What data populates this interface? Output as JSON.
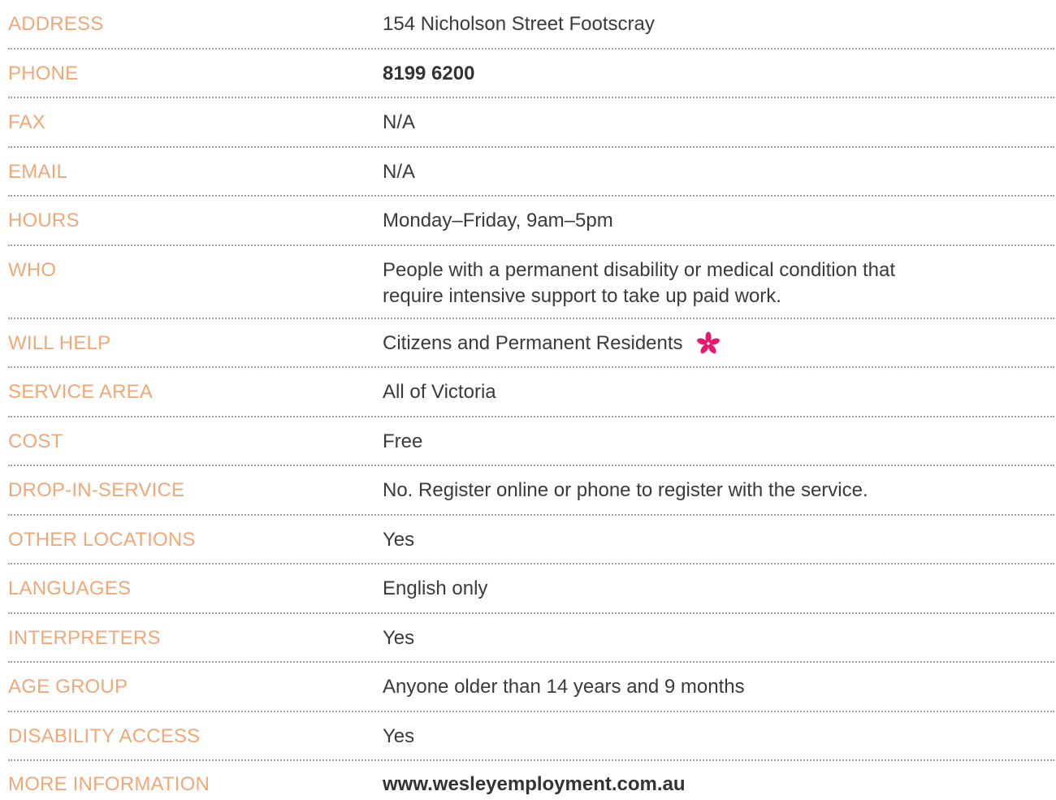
{
  "rows": [
    {
      "label": "ADDRESS",
      "value": "154 Nicholson Street Footscray"
    },
    {
      "label": "PHONE",
      "value": "8199 6200"
    },
    {
      "label": "FAX",
      "value": "N/A"
    },
    {
      "label": "EMAIL",
      "value": "N/A"
    },
    {
      "label": "HOURS",
      "value": "Monday–Friday, 9am–5pm"
    },
    {
      "label": "WHO",
      "value_line1": "People with a permanent disability or medical condition that",
      "value_line2": "require intensive support to take up paid work."
    },
    {
      "label": "WILL HELP",
      "value": "Citizens and Permanent Residents"
    },
    {
      "label": "SERVICE AREA",
      "value": "All of Victoria"
    },
    {
      "label": "COST",
      "value": "Free"
    },
    {
      "label": "DROP-IN-SERVICE",
      "value": "No. Register online or phone to register with the service."
    },
    {
      "label": "OTHER LOCATIONS",
      "value": "Yes"
    },
    {
      "label": "LANGUAGES",
      "value": "English only"
    },
    {
      "label": "INTERPRETERS",
      "value": "Yes"
    },
    {
      "label": "AGE GROUP",
      "value": "Anyone older than 14 years and 9 months"
    },
    {
      "label": "DISABILITY ACCESS",
      "value": "Yes"
    },
    {
      "label": "MORE INFORMATION",
      "value": "www.wesleyemployment.com.au"
    }
  ],
  "colors": {
    "label": "#f0a878",
    "value": "#3a3a3a",
    "asterisk": "#e8186e",
    "divider": "#a0a0a0"
  },
  "icons": {
    "will_help_marker": "asterisk-icon"
  }
}
